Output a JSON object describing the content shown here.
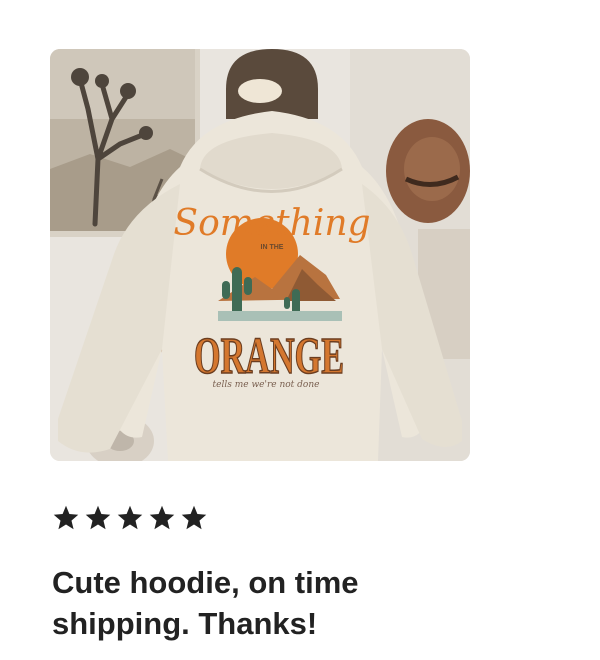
{
  "review": {
    "image": {
      "alt_icon": "hoodie-product-photo",
      "print": {
        "word_top": "Something",
        "word_small": "IN THE",
        "word_main": "ORANGE",
        "tagline": "tells me we're not done"
      }
    },
    "rating": {
      "value": 5,
      "max": 5,
      "star_icon": "star-icon",
      "star_color": "#222222"
    },
    "text": "Cute hoodie, on time\nshipping.  Thanks!"
  }
}
